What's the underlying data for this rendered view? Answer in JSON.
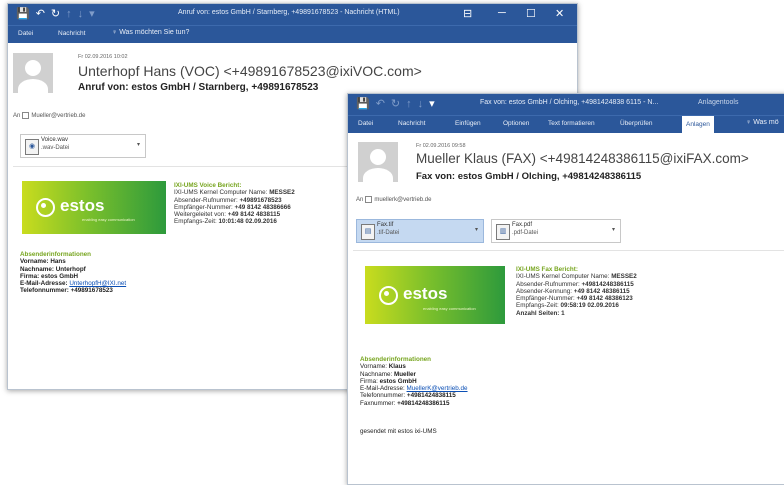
{
  "window1": {
    "quick_access": [
      "💾",
      "↶",
      "↻",
      "↑",
      "↓",
      "▾"
    ],
    "title": "Anruf von: estos GmbH / Starnberg, +49891678523 - Nachricht (HTML)",
    "window_controls": [
      "⊟",
      "─",
      "☐",
      "✕"
    ],
    "ribbon_tabs": [
      "Datei",
      "Nachricht"
    ],
    "tell_me": "♀ Was möchten Sie tun?",
    "date": "Fr 02.09.2016 10:02",
    "sender": "Unterhopf Hans (VOC) <+49891678523@ixiVOC.com>",
    "subject": "Anruf von: estos GmbH / Starnberg, +49891678523",
    "to_label": "An",
    "to_address": "Mueller@vertrieb.de",
    "attachment": {
      "name": "Voice.wav",
      "type": ".wav-Datei"
    },
    "logo": {
      "brand": "estos",
      "tagline": "enabling easy communication"
    },
    "report_title": "IXI-UMS Voice Bericht:",
    "report_lines": [
      {
        "label": "IXI-UMS Kernel Computer Name:",
        "value": "MESSE2"
      },
      {
        "label": "Absender-Rufnummer:",
        "value": "+49891678523"
      },
      {
        "label": "Empfänger-Nummer:",
        "value": "+49 8142 48386666"
      },
      {
        "label": "Weitergeleitet von:",
        "value": "+49 8142 4838115"
      },
      {
        "label": "Empfangs-Zeit:",
        "value": "10:01:48 02.09.2016"
      }
    ],
    "absender_title": "Absenderinformationen",
    "absender_lines": [
      {
        "label": "Vorname:",
        "value": "Hans"
      },
      {
        "label": "Nachname:",
        "value": "Unterhopf"
      },
      {
        "label": "Firma:",
        "value": "estos GmbH"
      },
      {
        "label": "E-Mail-Adresse:",
        "value": "UnterhopfH@IXI.net"
      },
      {
        "label": "Telefonnummer:",
        "value": "+49891678523"
      }
    ]
  },
  "window2": {
    "quick_access": [
      "💾",
      "↶",
      "↻",
      "↑",
      "↓",
      "▾"
    ],
    "title": "Fax von: estos GmbH / Olching, +4981424838 6115 - N...",
    "context_tab": "Anlagentools",
    "ribbon_tabs": [
      "Datei",
      "Nachricht",
      "Einfügen",
      "Optionen",
      "Text formatieren",
      "Überprüfen"
    ],
    "active_tab": "Anlagen",
    "tell_me": "♀ Was mö",
    "date": "Fr 02.09.2016 09:58",
    "sender": "Mueller Klaus (FAX) <+49814248386115@ixiFAX.com>",
    "subject": "Fax von: estos GmbH / Olching, +49814248386115",
    "to_label": "An",
    "to_address": "muellerk@vertrieb.de",
    "attachments": [
      {
        "name": "Fax.tif",
        "type": ".tif-Datei"
      },
      {
        "name": "Fax.pdf",
        "type": ".pdf-Datei"
      }
    ],
    "logo": {
      "brand": "estos",
      "tagline": "enabling easy communication"
    },
    "report_title": "IXI-UMS Fax Bericht:",
    "report_lines": [
      {
        "label": "IXI-UMS Kernel Computer Name:",
        "value": "MESSE2"
      },
      {
        "label": "Absender-Rufnummer:",
        "value": "+49814248386115"
      },
      {
        "label": "Absender-Kennung:",
        "value": "+49 8142 48386115"
      },
      {
        "label": "Empfänger-Nummer:",
        "value": "+49 8142 48386123"
      },
      {
        "label": "Empfangs-Zeit:",
        "value": "09:58:19 02.09.2016"
      },
      {
        "label": "Anzahl Seiten:",
        "value": "1"
      }
    ],
    "absender_title": "Absenderinformationen",
    "absender_lines": [
      {
        "label": "Vorname:",
        "value": "Klaus"
      },
      {
        "label": "Nachname:",
        "value": "Mueller"
      },
      {
        "label": "Firma:",
        "value": "estos GmbH"
      },
      {
        "label": "E-Mail-Adresse:",
        "value": "MuellerK@vertrieb.de"
      },
      {
        "label": "Telefonnummer:",
        "value": "+4981424838115"
      },
      {
        "label": "Faxnummer:",
        "value": "+49814248386115"
      }
    ],
    "footer": "gesendet mit estos ixi-UMS"
  },
  "colors": {
    "titlebar": "#2b579a",
    "accent_green": "#77a51f",
    "link": "#0b4fb5"
  }
}
